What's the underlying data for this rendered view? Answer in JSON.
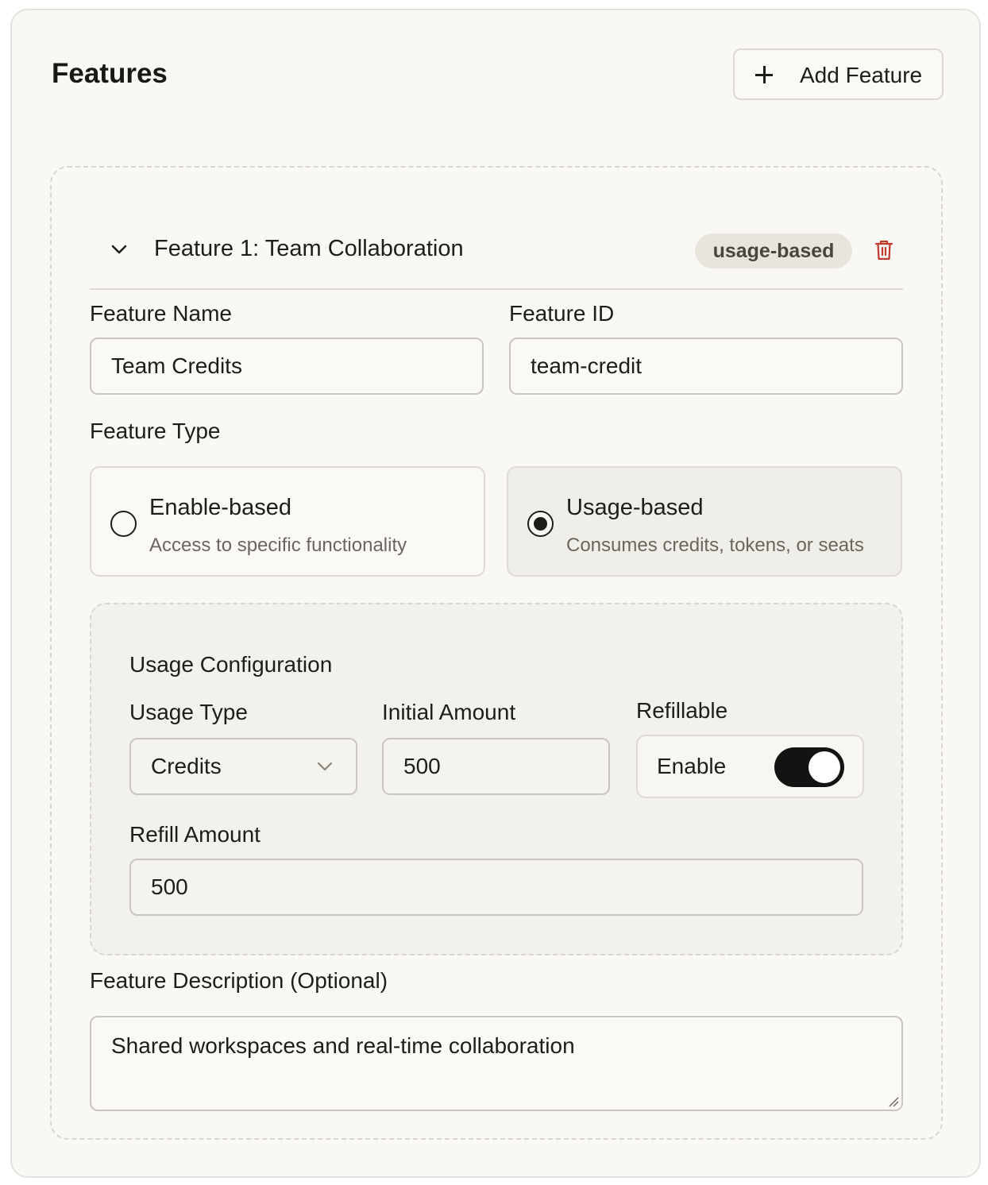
{
  "page": {
    "title": "Features",
    "add_button_label": "Add Feature"
  },
  "feature": {
    "title": "Feature 1: Team Collaboration",
    "badge": "usage-based",
    "name_label": "Feature Name",
    "name_value": "Team Credits",
    "id_label": "Feature ID",
    "id_value": "team-credit",
    "type_label": "Feature Type",
    "types": [
      {
        "name": "Enable-based",
        "description": "Access to specific functionality",
        "selected": false
      },
      {
        "name": "Usage-based",
        "description": "Consumes credits, tokens, or seats",
        "selected": true
      }
    ],
    "usage": {
      "title": "Usage Configuration",
      "usage_type_label": "Usage Type",
      "usage_type_value": "Credits",
      "initial_amount_label": "Initial Amount",
      "initial_amount_value": "500",
      "refillable_label": "Refillable",
      "refillable_toggle_label": "Enable",
      "refillable_on": true,
      "refill_amount_label": "Refill Amount",
      "refill_amount_value": "500"
    },
    "description_label": "Feature Description (Optional)",
    "description_value": "Shared workspaces and real-time collaboration"
  },
  "colors": {
    "accent": "#141311",
    "danger": "#c0392b",
    "badge_bg": "#e7e5dc"
  }
}
